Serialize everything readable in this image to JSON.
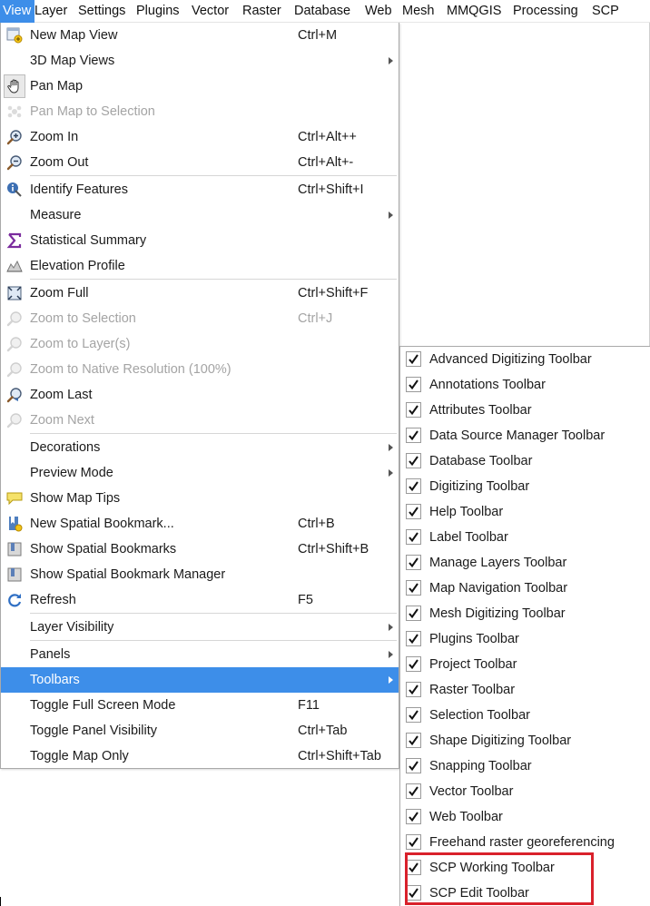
{
  "menubar": {
    "items": [
      {
        "name": "menu-view",
        "label": "View",
        "active": true,
        "width": 38
      },
      {
        "name": "menu-layer",
        "label": "Layer",
        "width": 48
      },
      {
        "name": "menu-settings",
        "label": "Settings",
        "width": 64
      },
      {
        "name": "menu-plugins",
        "label": "Plugins",
        "width": 61
      },
      {
        "name": "menu-vector",
        "label": "Vector",
        "width": 56
      },
      {
        "name": "menu-raster",
        "label": "Raster",
        "width": 57
      },
      {
        "name": "menu-database",
        "label": "Database",
        "width": 78
      },
      {
        "name": "menu-web",
        "label": "Web",
        "width": 41
      },
      {
        "name": "menu-mesh",
        "label": "Mesh",
        "width": 49
      },
      {
        "name": "menu-mmqgis",
        "label": "MMQGIS",
        "width": 73
      },
      {
        "name": "menu-processing",
        "label": "Processing",
        "width": 87
      },
      {
        "name": "menu-scp",
        "label": "SCP",
        "width": 34
      }
    ]
  },
  "view_menu": {
    "new_map_view": {
      "label": "New Map View",
      "shortcut": "Ctrl+M"
    },
    "map_views_3d": {
      "label": "3D Map Views"
    },
    "pan_map": {
      "label": "Pan Map"
    },
    "pan_to_selection": {
      "label": "Pan Map to Selection"
    },
    "zoom_in": {
      "label": "Zoom In",
      "shortcut": "Ctrl+Alt++"
    },
    "zoom_out": {
      "label": "Zoom Out",
      "shortcut": "Ctrl+Alt+-"
    },
    "identify": {
      "label": "Identify Features",
      "shortcut": "Ctrl+Shift+I"
    },
    "measure": {
      "label": "Measure"
    },
    "stat_summary": {
      "label": "Statistical Summary"
    },
    "elevation_profile": {
      "label": "Elevation Profile"
    },
    "zoom_full": {
      "label": "Zoom Full",
      "shortcut": "Ctrl+Shift+F"
    },
    "zoom_selection": {
      "label": "Zoom to Selection",
      "shortcut": "Ctrl+J"
    },
    "zoom_layers": {
      "label": "Zoom to Layer(s)"
    },
    "zoom_native": {
      "label": "Zoom to Native Resolution (100%)"
    },
    "zoom_last": {
      "label": "Zoom Last"
    },
    "zoom_next": {
      "label": "Zoom Next"
    },
    "decorations": {
      "label": "Decorations"
    },
    "preview_mode": {
      "label": "Preview Mode"
    },
    "map_tips": {
      "label": "Show Map Tips"
    },
    "new_bookmark": {
      "label": "New Spatial Bookmark...",
      "shortcut": "Ctrl+B"
    },
    "show_bookmarks": {
      "label": "Show Spatial Bookmarks",
      "shortcut": "Ctrl+Shift+B"
    },
    "bookmark_manager": {
      "label": "Show Spatial Bookmark Manager"
    },
    "refresh": {
      "label": "Refresh",
      "shortcut": "F5"
    },
    "layer_visibility": {
      "label": "Layer Visibility"
    },
    "panels": {
      "label": "Panels"
    },
    "toolbars": {
      "label": "Toolbars"
    },
    "full_screen": {
      "label": "Toggle Full Screen Mode",
      "shortcut": "F11"
    },
    "panel_visibility": {
      "label": "Toggle Panel Visibility",
      "shortcut": "Ctrl+Tab"
    },
    "map_only": {
      "label": "Toggle Map Only",
      "shortcut": "Ctrl+Shift+Tab"
    }
  },
  "toolbars_submenu": {
    "items": [
      "Advanced Digitizing Toolbar",
      "Annotations Toolbar",
      "Attributes Toolbar",
      "Data Source Manager Toolbar",
      "Database Toolbar",
      "Digitizing Toolbar",
      "Help Toolbar",
      "Label Toolbar",
      "Manage Layers Toolbar",
      "Map Navigation Toolbar",
      "Mesh Digitizing Toolbar",
      "Plugins Toolbar",
      "Project Toolbar",
      "Raster Toolbar",
      "Selection Toolbar",
      "Shape Digitizing Toolbar",
      "Snapping Toolbar",
      "Vector Toolbar",
      "Web Toolbar",
      "Freehand raster georeferencing",
      "SCP Working Toolbar",
      "SCP Edit Toolbar"
    ],
    "checked": [
      true,
      true,
      true,
      true,
      true,
      true,
      true,
      true,
      true,
      true,
      true,
      true,
      true,
      true,
      true,
      true,
      true,
      true,
      true,
      true,
      true,
      true
    ]
  },
  "colors": {
    "selection": "#3d8ee9",
    "highlight_box": "#d9212b",
    "disabled_text": "#a4a4a4"
  }
}
